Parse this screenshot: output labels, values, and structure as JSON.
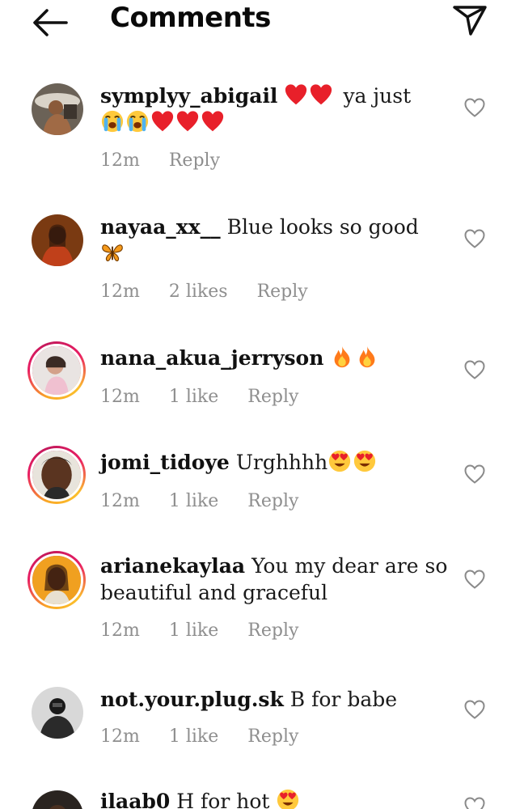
{
  "header": {
    "title": "Comments",
    "back_icon": "arrow-left-icon",
    "share_icon": "paper-plane-icon"
  },
  "colors": {
    "meta_text": "#8e8e8e",
    "heart": "#e8202a",
    "story_ring": "#e91e63"
  },
  "comments": [
    {
      "username": "symplyy_abigail",
      "text_a": "ya just",
      "emoji_a": [
        "red-heart",
        "red-heart"
      ],
      "emoji_b": [
        "crying-face",
        "crying-face",
        "red-heart",
        "red-heart",
        "red-heart"
      ],
      "time": "12m",
      "likes": "",
      "reply": "Reply"
    },
    {
      "username": "nayaa_xx__",
      "text_a": "Blue looks so good",
      "emoji_b": [
        "butterfly"
      ],
      "time": "12m",
      "likes": "2 likes",
      "reply": "Reply"
    },
    {
      "username": "nana_akua_jerryson",
      "emoji_a": [
        "fire",
        "fire"
      ],
      "time": "12m",
      "likes": "1 like",
      "reply": "Reply"
    },
    {
      "username": "jomi_tidoye",
      "text_a": "Urghhhh",
      "emoji_a": [
        "heart-eyes",
        "heart-eyes"
      ],
      "time": "12m",
      "likes": "1 like",
      "reply": "Reply"
    },
    {
      "username": "arianekaylaa",
      "text_a": "You my dear are so beautiful and graceful",
      "time": "12m",
      "likes": "1 like",
      "reply": "Reply"
    },
    {
      "username": "not.your.plug.sk",
      "text_a": "B for babe",
      "time": "12m",
      "likes": "1 like",
      "reply": "Reply"
    },
    {
      "username": "ilaab0",
      "text_a": "H for hot",
      "emoji_a": [
        "heart-eyes"
      ]
    }
  ]
}
